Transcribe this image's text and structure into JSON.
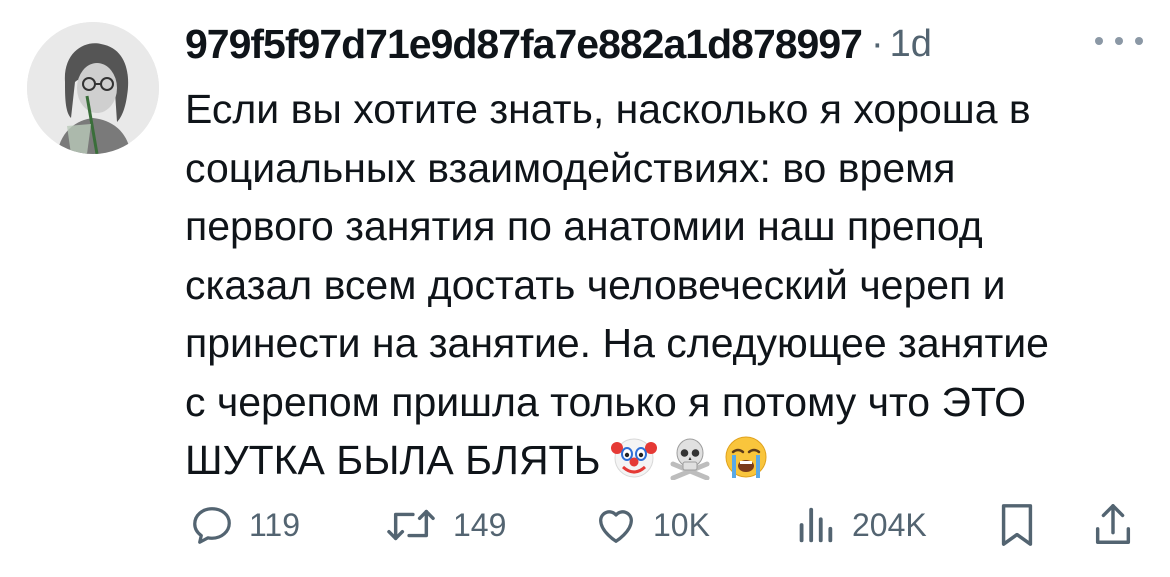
{
  "tweet": {
    "username": "979f5f97d71e9d87fa7e882a1d878997",
    "separator": "·",
    "time": "1d",
    "lines": [
      "Если вы хотите знать, насколько я хороша в",
      "социальных взаимодействиях: во время",
      "первого занятия по анатомии наш препод",
      "сказал всем достать человеческий череп и",
      "принести на занятие. На следующее занятие",
      "с черепом пришла только я потому что ЭТО",
      "ШУТКА БЫЛА БЛЯТЬ"
    ],
    "emojis": [
      "clown-face",
      "skull-and-crossbones",
      "loudly-crying-face"
    ]
  },
  "actions": {
    "replies": "119",
    "reposts": "149",
    "likes": "10K",
    "views": "204K"
  },
  "icons": [
    "more-icon",
    "reply-icon",
    "repost-icon",
    "like-icon",
    "views-icon",
    "bookmark-icon",
    "share-icon"
  ],
  "colors": {
    "text": "#0f1419",
    "secondary": "#536471"
  }
}
